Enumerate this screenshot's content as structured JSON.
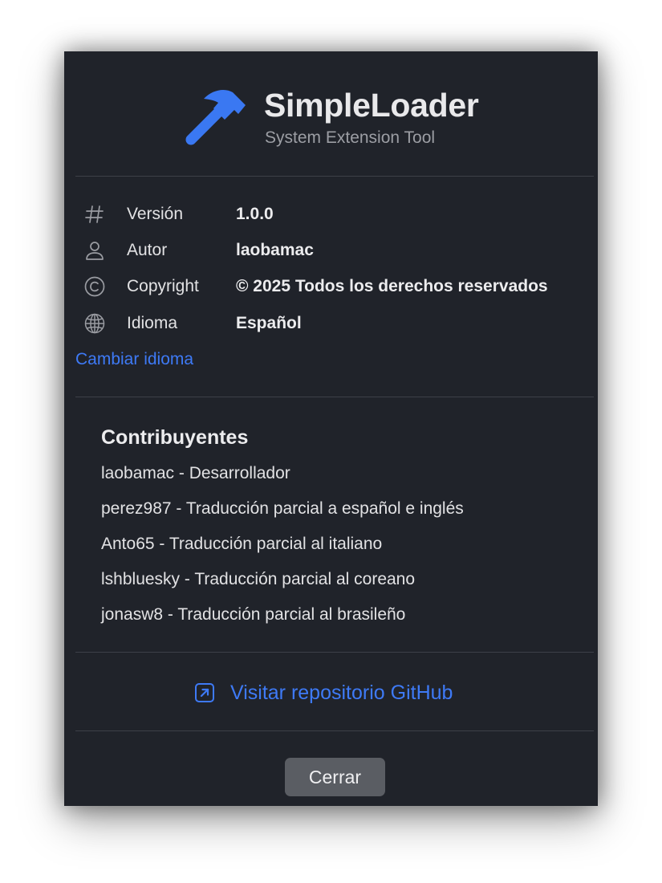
{
  "app": {
    "title": "SimpleLoader",
    "subtitle": "System Extension Tool",
    "icon": "hammer-icon",
    "accent_color": "#3e7af6",
    "background_color": "#20232a"
  },
  "info": {
    "rows": [
      {
        "icon": "hash-icon",
        "label": "Versión",
        "value": "1.0.0"
      },
      {
        "icon": "person-icon",
        "label": "Autor",
        "value": "laobamac"
      },
      {
        "icon": "copyright-icon",
        "label": "Copyright",
        "value": "© 2025 Todos los derechos reservados"
      },
      {
        "icon": "globe-icon",
        "label": "Idioma",
        "value": "Español"
      }
    ],
    "change_language_label": "Cambiar idioma"
  },
  "contributors": {
    "title": "Contribuyentes",
    "items": [
      "laobamac - Desarrollador",
      "perez987 - Traducción parcial a español e inglés",
      "Anto65 - Traducción parcial al italiano",
      "lshbluesky - Traducción parcial al coreano",
      "jonasw8 - Traducción parcial al brasileño"
    ]
  },
  "github": {
    "icon": "external-link-icon",
    "label": "Visitar repositorio GitHub"
  },
  "footer": {
    "close_label": "Cerrar"
  }
}
